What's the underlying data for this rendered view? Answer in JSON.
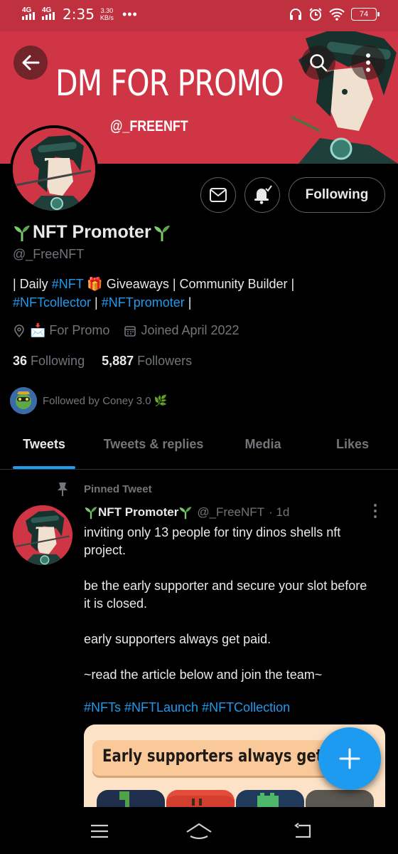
{
  "status_bar": {
    "net1": "4G",
    "net2": "4G",
    "time": "2:35",
    "speed_value": "3.30",
    "speed_unit": "KB/s",
    "dots": "•••",
    "battery": "74"
  },
  "banner": {
    "title": "DM FOR PROMO",
    "handle": "@_FREENFT"
  },
  "profile": {
    "display_name": "NFT Promoter",
    "username": "@_FreeNFT",
    "follow_label": "Following",
    "bio": {
      "p1": "| Daily ",
      "t1": "#NFT",
      "p2": " 🎁 Giveaways | Community Builder |",
      "t2": "#NFTcollector",
      "p3": " | ",
      "t3": "#NFTpromoter",
      "p4": " |"
    },
    "location": "📩 For Promo",
    "joined": "Joined April 2022",
    "following_count": "36",
    "following_label": "Following",
    "followers_count": "5,887",
    "followers_label": "Followers",
    "followed_by": "Followed by Coney 3.0 🌿"
  },
  "tabs": [
    "Tweets",
    "Tweets & replies",
    "Media",
    "Likes"
  ],
  "tweet": {
    "pinned_label": "Pinned Tweet",
    "author_name": "NFT Promoter",
    "author_handle": "@_FreeNFT",
    "time": "· 1d",
    "para1": "inviting only 13 people for tiny dinos shells nft project.",
    "para2": "be the early supporter and secure your slot before it is closed.",
    "para3": "early supporters always get paid.",
    "para4": "~read the article below and join the team~",
    "hashtags": "#NFTs #NFTLaunch #NFTCollection",
    "card_text": "Early supporters always get"
  },
  "colors": {
    "accent": "#1d9bf0",
    "banner": "#cf3545",
    "status_bar": "#c0313f",
    "muted": "#71767b"
  },
  "icons": [
    "back-arrow-icon",
    "search-icon",
    "more-vertical-icon",
    "mail-icon",
    "bell-icon",
    "location-icon",
    "calendar-icon",
    "pin-icon",
    "plus-icon",
    "menu-icon",
    "home-icon",
    "back-nav-icon",
    "sprout-icon",
    "headphones-icon",
    "alarm-icon",
    "wifi-icon"
  ]
}
